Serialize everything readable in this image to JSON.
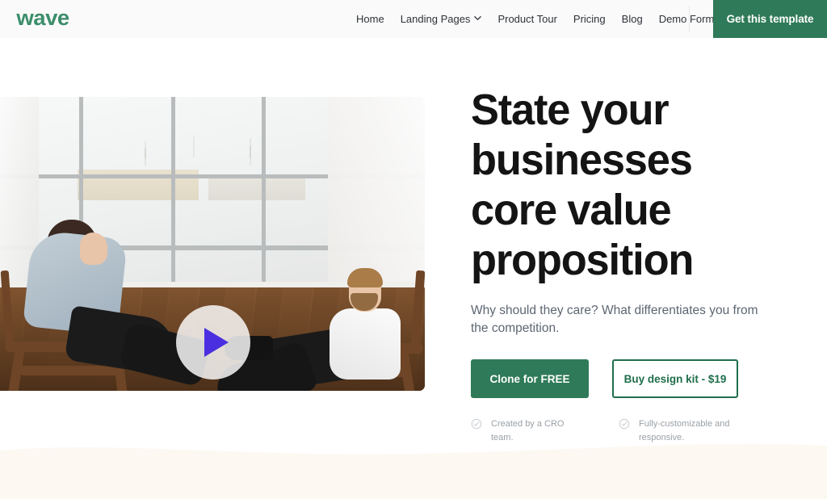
{
  "brand": {
    "logo_text": "wave",
    "green": "#2f7a58",
    "logo_green": "#3c8e6b"
  },
  "header": {
    "nav": [
      {
        "label": "Home",
        "has_dropdown": false
      },
      {
        "label": "Landing Pages",
        "has_dropdown": true,
        "icon": "chevron-down-icon"
      },
      {
        "label": "Product Tour",
        "has_dropdown": false
      },
      {
        "label": "Pricing",
        "has_dropdown": false
      },
      {
        "label": "Blog",
        "has_dropdown": false
      },
      {
        "label": "Demo Form",
        "has_dropdown": false
      }
    ],
    "cta_label": "Get this template"
  },
  "hero": {
    "headline": "State your businesses core value proposition",
    "subhead": "Why should they care? What differentiates you from the competition.",
    "primary_button": "Clone for FREE",
    "outline_button": "Buy design kit - $19",
    "features": [
      {
        "icon": "check-circle-icon",
        "text": "Created by a CRO team."
      },
      {
        "icon": "check-circle-icon",
        "text": "Fully-customizable and responsive."
      }
    ],
    "media": {
      "icon": "play-icon",
      "play_color": "#4a2fe0",
      "alt": "Two people seated in wooden armchairs talking in a bright room with large windows"
    }
  },
  "wave_section": {
    "background": "#fdf8f2"
  }
}
